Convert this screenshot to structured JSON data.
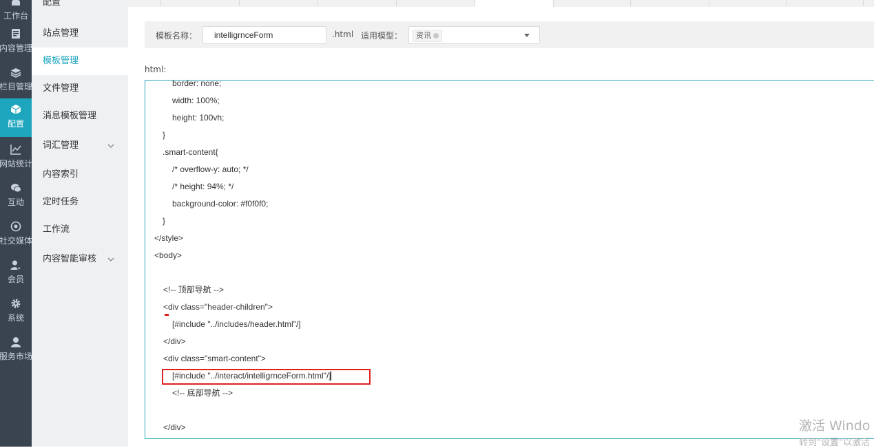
{
  "rail": [
    {
      "label": "工作台",
      "icon": "home-icon"
    },
    {
      "label": "内容管理",
      "icon": "document-icon"
    },
    {
      "label": "栏目管理",
      "icon": "layers-icon"
    },
    {
      "label": "配置",
      "icon": "cube-icon",
      "active": true
    },
    {
      "label": "网站统计",
      "icon": "line-chart-icon"
    },
    {
      "label": "互动",
      "icon": "chat-icon"
    },
    {
      "label": "社交媒体",
      "icon": "target-icon"
    },
    {
      "label": "会员",
      "icon": "user-check-icon"
    },
    {
      "label": "系统",
      "icon": "gear-icon"
    },
    {
      "label": "服务市场",
      "icon": "person-icon"
    }
  ],
  "submenu": {
    "title": "配置",
    "items": [
      {
        "label": "站点管理"
      },
      {
        "label": "模板管理",
        "active": true
      },
      {
        "label": "文件管理"
      },
      {
        "label": "消息模板管理"
      },
      {
        "label": "词汇管理",
        "expandable": true
      },
      {
        "label": "内容索引"
      },
      {
        "label": "定时任务"
      },
      {
        "label": "工作流"
      },
      {
        "label": "内容智能审核",
        "expandable": true
      }
    ]
  },
  "form": {
    "template_name_label": "模板名称：",
    "template_name_value": "intelligrnceForm",
    "suffix": ".html",
    "model_label": "适用模型：",
    "model_tag": "资讯"
  },
  "editor": {
    "label": "html:",
    "lines": [
      "border: none;",
      "width: 100%;",
      "height: 100vh;",
      "}",
      ".smart-content{",
      "/* overflow-y: auto; */",
      "/* height: 94%; */",
      "background-color: #f0f0f0;",
      "}",
      "</style>",
      "<body>",
      "",
      "<!-- 顶部导航 -->",
      "<div class=\"header-children\">",
      "[#include \"../includes/header.html\"/]",
      "</div>",
      "<div class=\"smart-content\">",
      "[#include \"../interact/intelligrnceForm.html\"/]",
      "<!-- 底部导航 -->",
      "",
      "</div>"
    ]
  },
  "watermark": {
    "line1": "激活 Windo",
    "line2": "转到\"设置\"以激活"
  },
  "colors": {
    "accent": "#1ea6bf",
    "rail_bg": "#3a4450",
    "highlight": "#e02020"
  }
}
